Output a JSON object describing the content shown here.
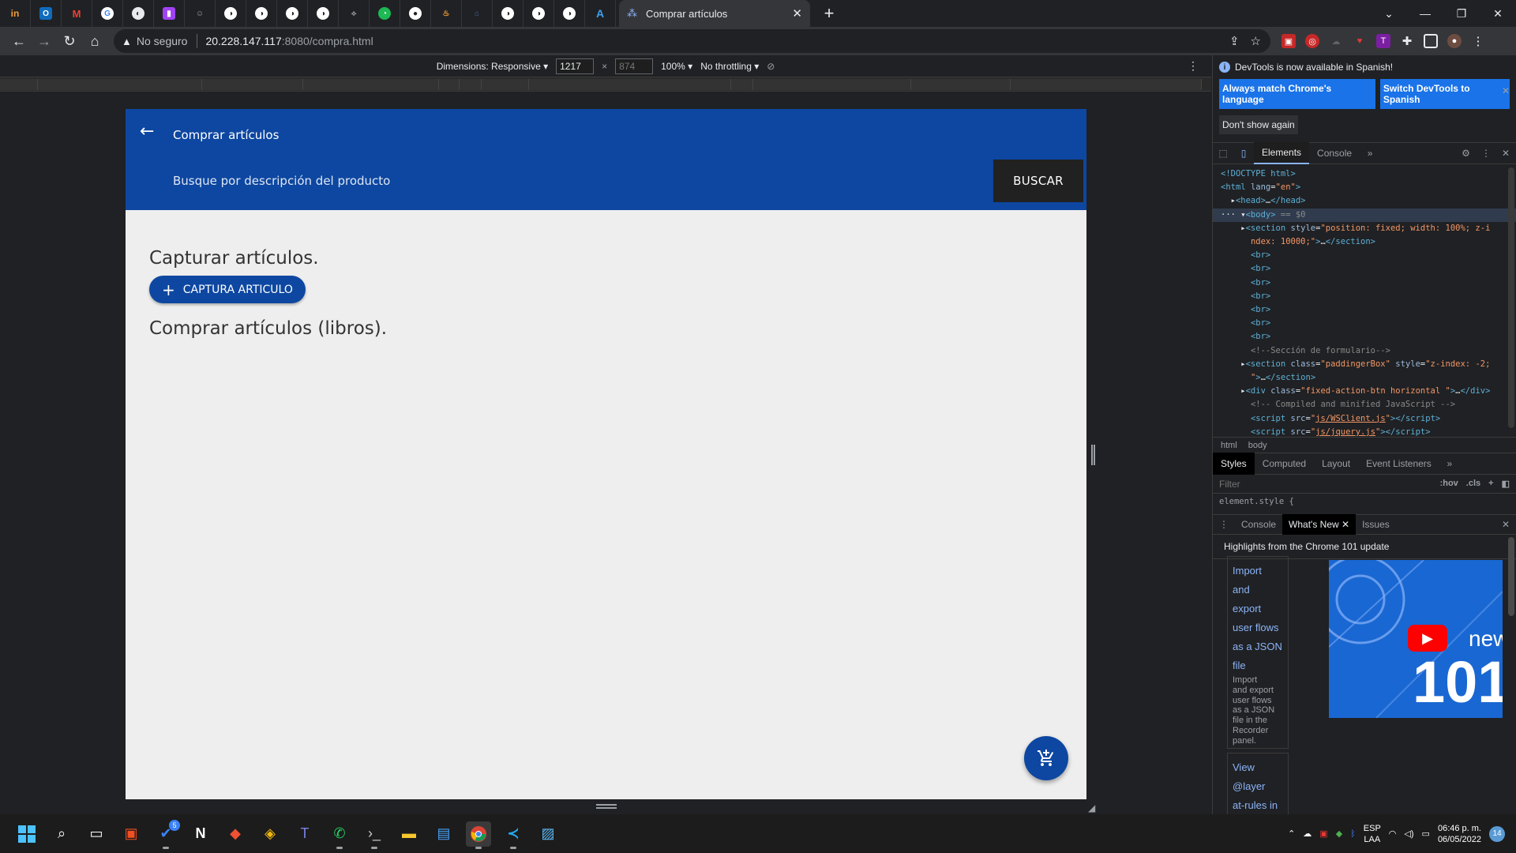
{
  "browser": {
    "active_tab_title": "Comprar artículos",
    "address": {
      "security": "No seguro",
      "host": "20.228.147.117",
      "path": ":8080/compra.html"
    }
  },
  "device_toolbar": {
    "dimensions_label": "Dimensions: Responsive",
    "width": "1217",
    "height": "874",
    "zoom": "100%",
    "throttling": "No throttling"
  },
  "page": {
    "appbar_title": "Comprar artículos",
    "search_placeholder": "Busque por descripción del producto",
    "search_button": "BUSCAR",
    "heading_capture": "Capturar artículos.",
    "capture_button": "CAPTURA ARTICULO",
    "heading_buy": "Comprar artículos (libros)."
  },
  "devtools": {
    "info_text": "DevTools is now available in Spanish!",
    "btn_match": "Always match Chrome's language",
    "btn_switch": "Switch DevTools to Spanish",
    "btn_dont_show": "Don't show again",
    "tabs": {
      "elements": "Elements",
      "console": "Console"
    },
    "breadcrumbs": [
      "html",
      "body"
    ],
    "styles_tabs": {
      "styles": "Styles",
      "computed": "Computed",
      "layout": "Layout",
      "listeners": "Event Listeners"
    },
    "filter_placeholder": "Filter",
    "filter_hov": ":hov",
    "filter_cls": ".cls",
    "element_style": "element.style {",
    "drawer_tabs": {
      "console": "Console",
      "whats_new": "What's New",
      "issues": "Issues"
    },
    "highlights": "Highlights from the Chrome 101 update",
    "card1_title": [
      "Import",
      "and",
      "export",
      "user flows",
      "as a JSON",
      "file"
    ],
    "card1_body": [
      "Import",
      "and export",
      "user flows",
      "as a JSON",
      "file in the",
      "Recorder",
      "panel."
    ],
    "card2_title": [
      "View",
      "@layer",
      "at-rules in"
    ],
    "video_text": "new",
    "video_number": "101"
  },
  "taskbar": {
    "lang_top": "ESP",
    "lang_bottom": "LAA",
    "time": "06:46 p. m.",
    "date": "06/05/2022",
    "notif_count": "14",
    "todo_badge": "5"
  }
}
